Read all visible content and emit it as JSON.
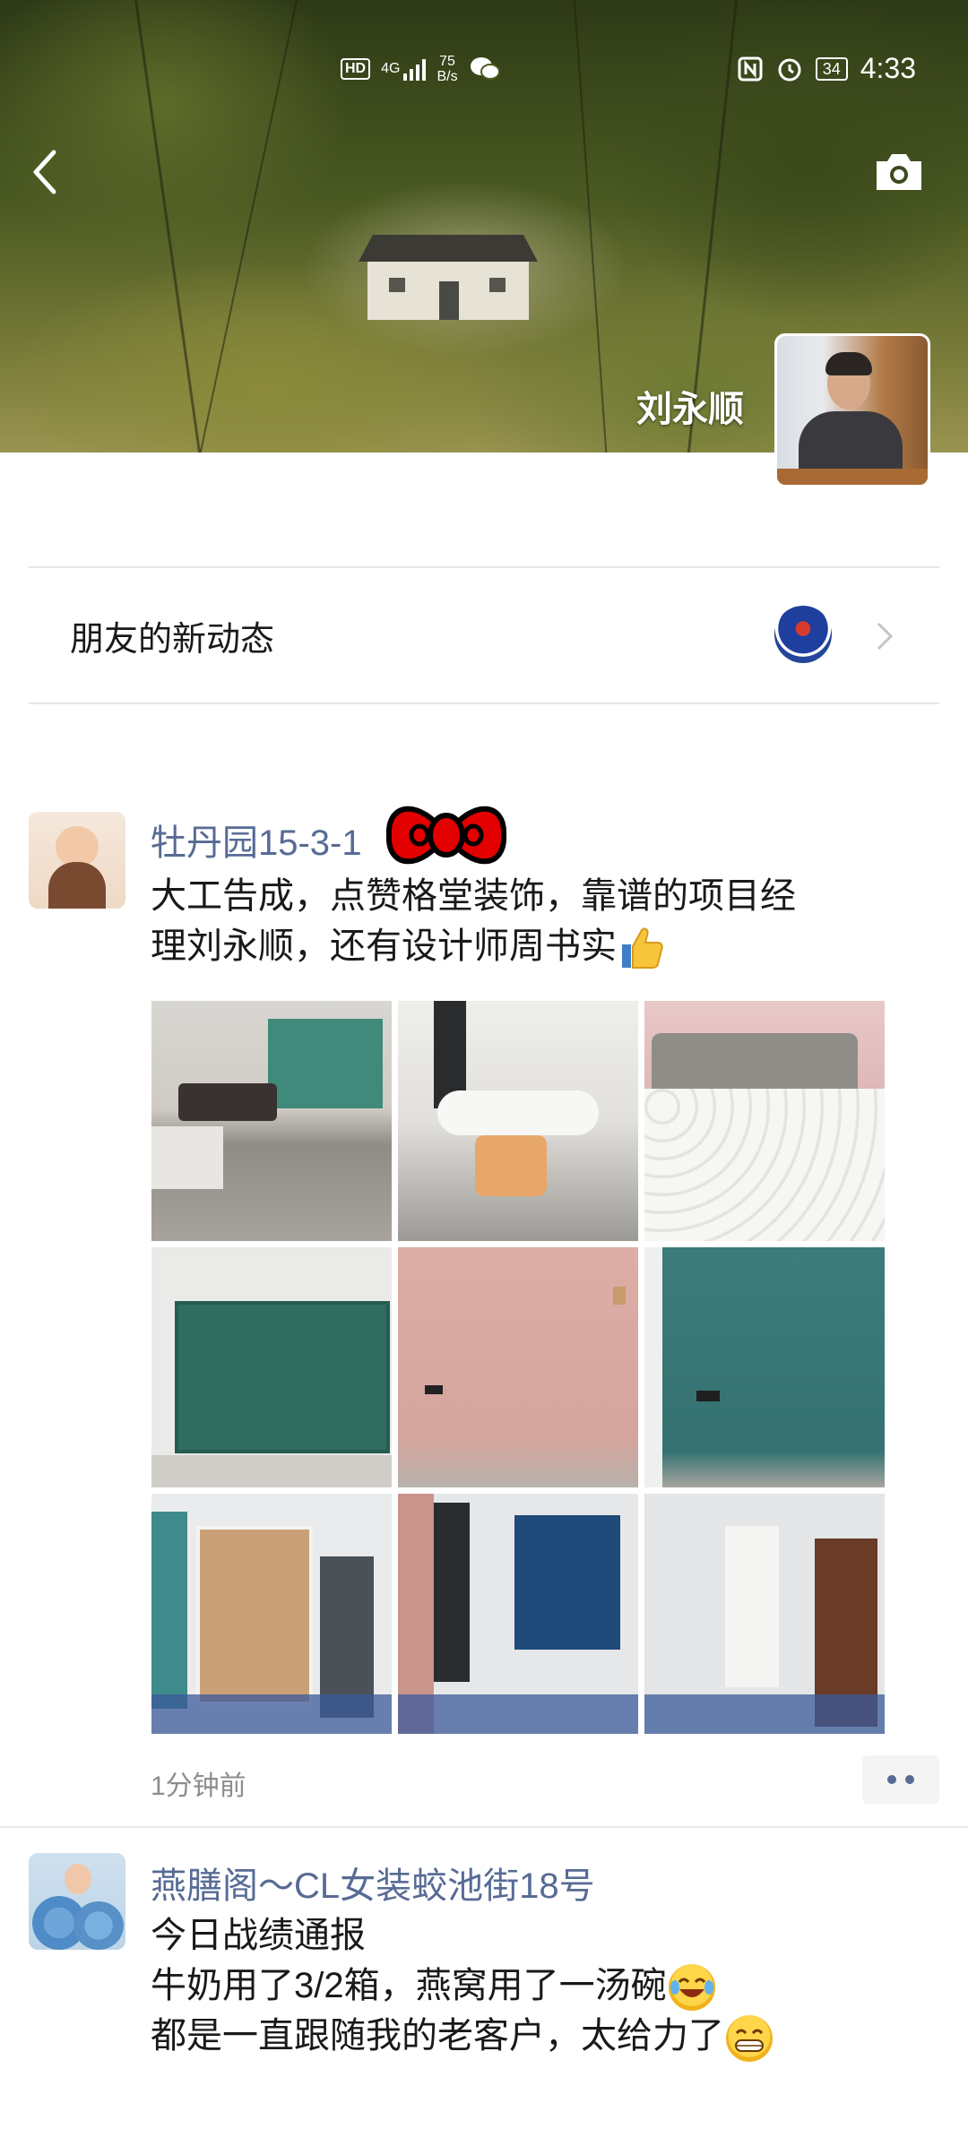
{
  "status_bar": {
    "hd": "HD",
    "network": "4G",
    "speed_value": "75",
    "speed_unit": "B/s",
    "battery": "34",
    "time": "4:33"
  },
  "cover": {
    "owner_name": "刘永顺"
  },
  "friends_updates": {
    "label": "朋友的新动态"
  },
  "posts": [
    {
      "author": "牡丹园15-3-1",
      "lines": [
        "大工告成，点赞格堂装饰，靠谱的项目经",
        "理刘永顺，还有设计师周书实"
      ],
      "photos": [
        "living-room",
        "dining-table",
        "mattress",
        "green-wall-panels",
        "pink-wall",
        "teal-wall",
        "wardrobe",
        "window-room",
        "hallway-room"
      ],
      "time": "1分钟前"
    },
    {
      "author": "燕膳阁～CL女装蛟池街18号",
      "lines": [
        "今日战绩通报",
        "牛奶用了3/2箱，燕窝用了一汤碗",
        "都是一直跟随我的老客户，太给力了"
      ]
    }
  ],
  "icons": {
    "back": "back-arrow-icon",
    "camera": "camera-icon",
    "chevron": "chevron-right-icon",
    "more": "more-dots-icon"
  },
  "colors": {
    "link": "#576b95",
    "text": "#191919",
    "meta": "#8d8d8d"
  }
}
